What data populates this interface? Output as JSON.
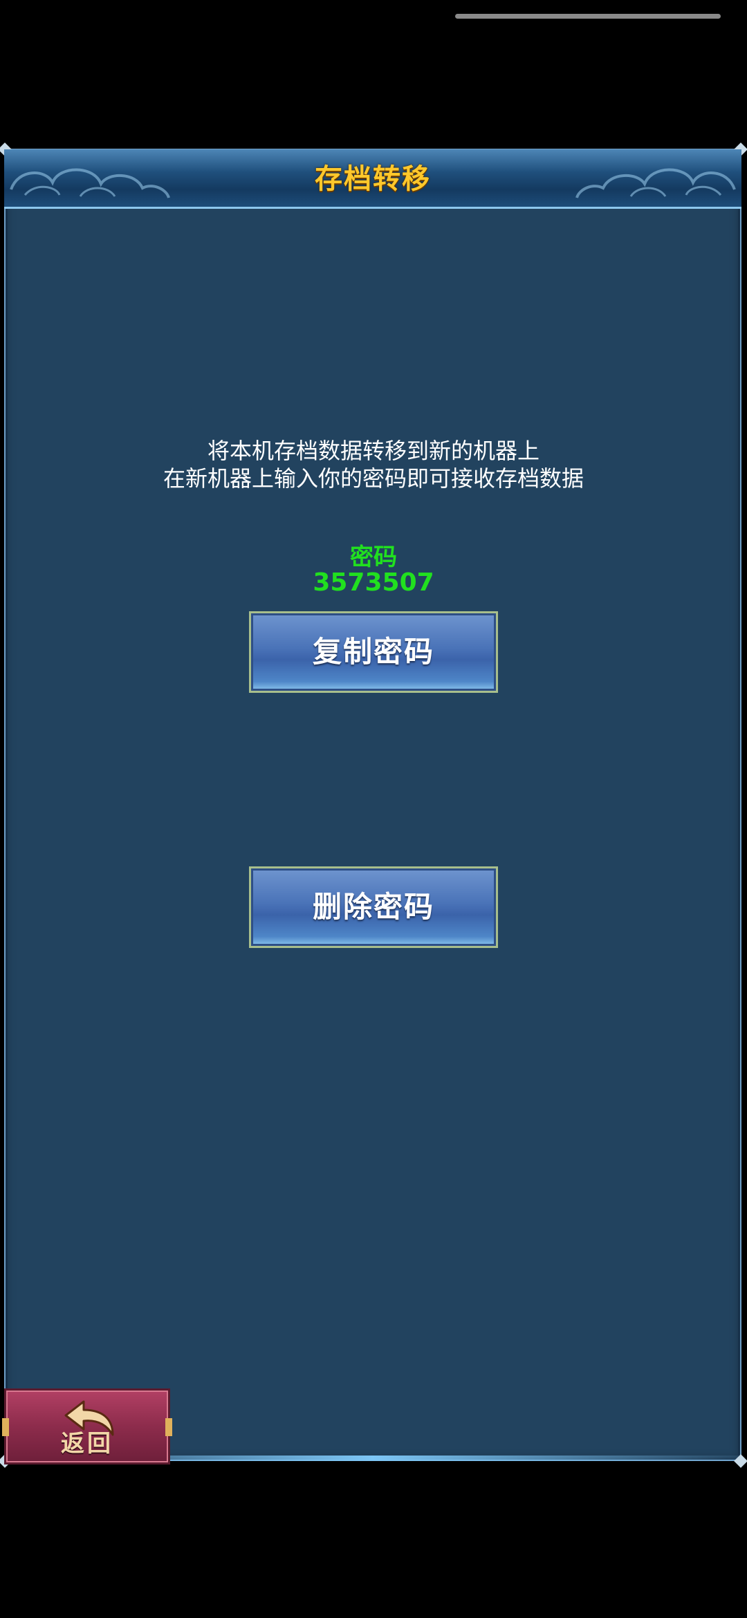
{
  "dialog": {
    "title": "存档转移",
    "description_line1": "将本机存档数据转移到新的机器上",
    "description_line2": "在新机器上输入你的密码即可接收存档数据",
    "password_label": "密码",
    "password_value": "3573507"
  },
  "buttons": {
    "copy_password": "复制密码",
    "delete_password": "删除密码",
    "back": "返回"
  },
  "colors": {
    "panel_bg": "#22435f",
    "title_text": "#ffc82b",
    "password_text": "#21e01f",
    "button_blue": "#4a73b8",
    "back_button": "#8d2c4c"
  },
  "icons": {
    "back": "back-arrow-icon"
  }
}
